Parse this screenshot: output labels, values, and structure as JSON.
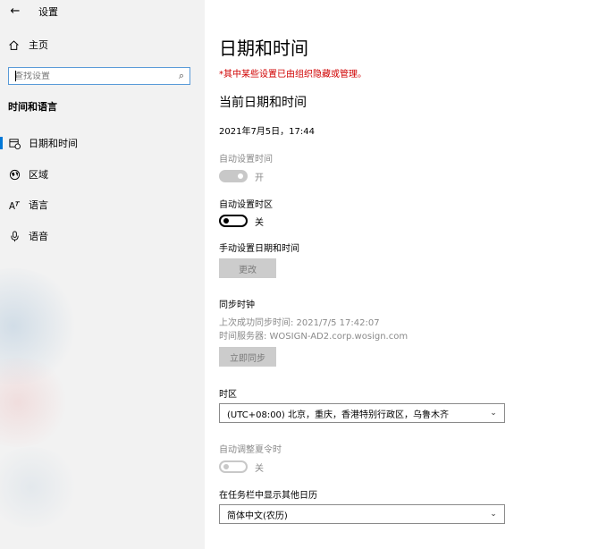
{
  "app": {
    "title": "设置",
    "back_icon": "back-arrow-icon"
  },
  "sidebar": {
    "home_label": "主页",
    "search_placeholder": "查找设置",
    "section_title": "时间和语言",
    "items": [
      {
        "label": "日期和时间",
        "icon": "calendar-clock-icon",
        "selected": true
      },
      {
        "label": "区域",
        "icon": "globe-icon",
        "selected": false
      },
      {
        "label": "语言",
        "icon": "language-icon",
        "selected": false
      },
      {
        "label": "语音",
        "icon": "microphone-icon",
        "selected": false
      }
    ]
  },
  "main": {
    "page_title": "日期和时间",
    "policy_warning": "*其中某些设置已由组织隐藏或管理。",
    "current_heading": "当前日期和时间",
    "current_datetime": "2021年7月5日，17:44",
    "auto_time": {
      "label": "自动设置时间",
      "state_text": "开",
      "on": true,
      "disabled": true
    },
    "auto_timezone": {
      "label": "自动设置时区",
      "state_text": "关",
      "on": false,
      "disabled": false
    },
    "manual": {
      "label": "手动设置日期和时间",
      "button": "更改"
    },
    "sync": {
      "heading": "同步时钟",
      "last_success": "上次成功同步时间: 2021/7/5 17:42:07",
      "server": "时间服务器: WOSIGN-AD2.corp.wosign.com",
      "button": "立即同步"
    },
    "timezone": {
      "label": "时区",
      "value": "(UTC+08:00) 北京，重庆，香港特别行政区，乌鲁木齐"
    },
    "dst": {
      "label": "自动调整夏令时",
      "state_text": "关",
      "on": false,
      "disabled": true
    },
    "calendar": {
      "label": "在任务栏中显示其他日历",
      "value": "简体中文(农历)"
    }
  },
  "colors": {
    "accent": "#0078d7",
    "warning": "#d00000",
    "disabled_text": "#8a8a8a",
    "sidebar_bg": "#f2f2f2"
  }
}
